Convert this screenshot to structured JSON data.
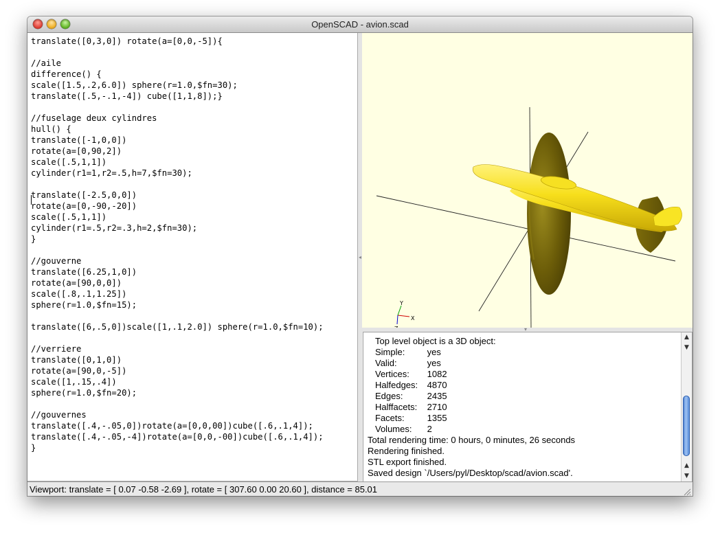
{
  "window": {
    "title": "OpenSCAD - avion.scad"
  },
  "editor": {
    "code": "translate([0,3,0]) rotate(a=[0,0,-5]){\n\n//aile\ndifference() {\nscale([1.5,.2,6.0]) sphere(r=1.0,$fn=30);\ntranslate([.5,-.1,-4]) cube([1,1,8]);}\n\n//fuselage deux cylindres\nhull() {\ntranslate([-1,0,0])\nrotate(a=[0,90,2])\nscale([.5,1,1])\ncylinder(r1=1,r2=.5,h=7,$fn=30);\n\ntranslate([-2.5,0,0])\nrotate(a=[0,-90,-20])\nscale([.5,1,1])\ncylinder(r1=.5,r2=.3,h=2,$fn=30);\n}\n\n//gouverne\ntranslate([6.25,1,0])\nrotate(a=[90,0,0])\nscale([.8,.1,1.25])\nsphere(r=1.0,$fn=15);\n\ntranslate([6,.5,0])scale([1,.1,2.0]) sphere(r=1.0,$fn=10);\n\n//verriere\ntranslate([0,1,0])\nrotate(a=[90,0,-5])\nscale([1,.15,.4])\nsphere(r=1.0,$fn=20);\n\n//gouvernes\ntranslate([.4,-.05,0])rotate(a=[0,0,00])cube([.6,.1,4]);\ntranslate([.4,-.05,-4])rotate(a=[0,0,-00])cube([.6,.1,4]);\n}"
  },
  "viewer": {
    "background": "#ffffe3",
    "model_color": "#f8e800",
    "axis_labels": {
      "x": "X",
      "y": "Y",
      "z": "Z"
    }
  },
  "console": {
    "lines": [
      "Top level object is a 3D object:",
      "Total rendering time: 0 hours, 0 minutes, 26 seconds",
      "Rendering finished.",
      "STL export finished.",
      "Saved design `/Users/pyl/Desktop/scad/avion.scad'."
    ],
    "stats": [
      {
        "label": "Simple:",
        "value": "yes"
      },
      {
        "label": "Valid:",
        "value": "yes"
      },
      {
        "label": "Vertices:",
        "value": "1082"
      },
      {
        "label": "Halfedges:",
        "value": "4870"
      },
      {
        "label": "Edges:",
        "value": "2435"
      },
      {
        "label": "Halffacets:",
        "value": "2710"
      },
      {
        "label": "Facets:",
        "value": "1355"
      },
      {
        "label": "Volumes:",
        "value": "2"
      }
    ]
  },
  "statusbar": {
    "text": "Viewport: translate = [ 0.07 -0.58 -2.69 ], rotate = [ 307.60 0.00 20.60 ], distance = 85.01"
  }
}
